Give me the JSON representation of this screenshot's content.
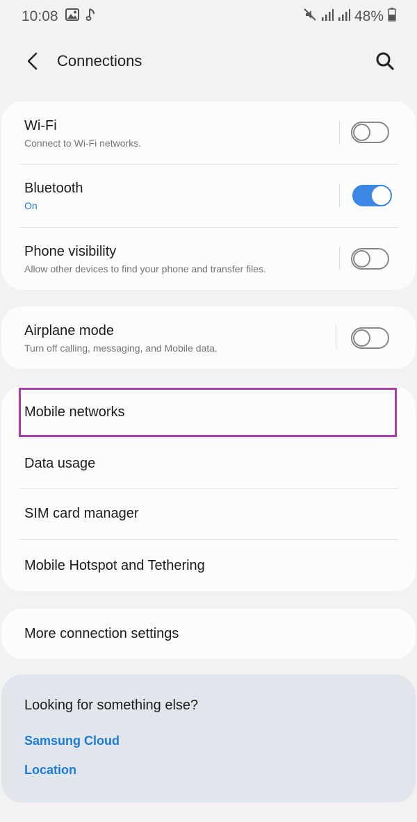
{
  "status_bar": {
    "time": "10:08",
    "battery": "48%",
    "icons": [
      "gallery-icon",
      "music-note-icon",
      "mute-icon",
      "signal-icon",
      "signal-icon",
      "battery-icon"
    ]
  },
  "app_bar": {
    "title": "Connections",
    "back_icon": "back-arrow-icon",
    "search_icon": "search-icon"
  },
  "card1": {
    "wifi": {
      "title": "Wi-Fi",
      "subtitle": "Connect to Wi-Fi networks.",
      "enabled": false
    },
    "bluetooth": {
      "title": "Bluetooth",
      "subtitle": "On",
      "enabled": true
    },
    "phone_visibility": {
      "title": "Phone visibility",
      "subtitle": "Allow other devices to find your phone and transfer files.",
      "enabled": false
    }
  },
  "card2": {
    "airplane": {
      "title": "Airplane mode",
      "subtitle": "Turn off calling, messaging, and Mobile data.",
      "enabled": false
    }
  },
  "card3": {
    "items": [
      "Mobile networks",
      "Data usage",
      "SIM card manager",
      "Mobile Hotspot and Tethering"
    ]
  },
  "card4": {
    "more": "More connection settings"
  },
  "suggestions": {
    "title": "Looking for something else?",
    "links": [
      "Samsung Cloud",
      "Location"
    ]
  },
  "colors": {
    "accent": "#3a87e5",
    "link": "#1b7bd6",
    "highlight": "#a93ca8",
    "background": "#f2f2f2",
    "card": "#fcfcfc",
    "suggestion_card": "#e1e6ec"
  }
}
